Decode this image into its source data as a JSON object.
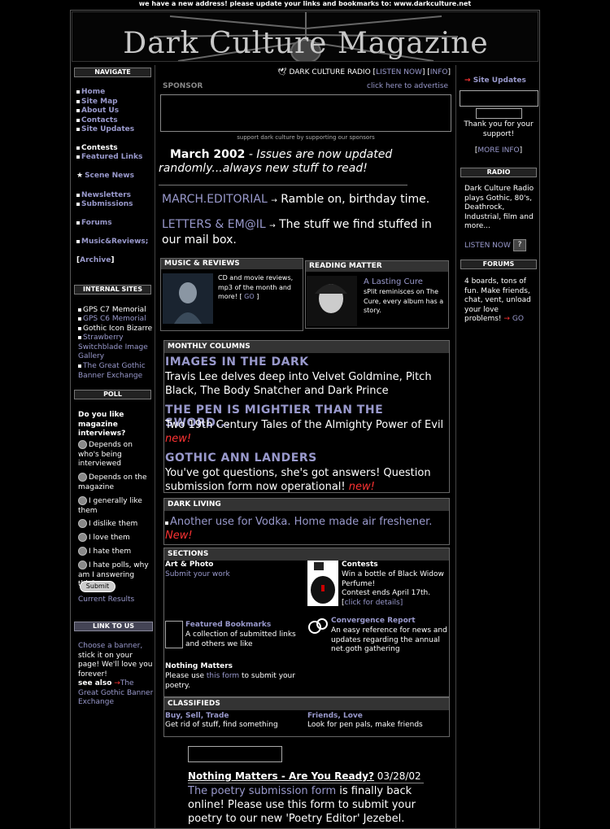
{
  "notice": "we have a new address! please update your links and bookmarks to: www.darkculture.net",
  "banner_title": "Dark Culture Magazine",
  "nav": {
    "header": "NAVIGATE",
    "items": [
      "Home",
      "Site Map",
      "About Us",
      "Contacts",
      "Site Updates"
    ],
    "contests": "Contests",
    "featured": "Featured Links",
    "scene": "Scene News",
    "newsletters": "Newsletters",
    "submissions": "Submissions",
    "forums": "Forums",
    "music": "Music&Reviews;",
    "archive": "Archive"
  },
  "internal": {
    "header": "INTERNAL SITES",
    "items": [
      "GPS C7 Memorial",
      "GPS C6 Memorial",
      "Gothic Icon Bizarre",
      "Strawberry Switchblade Image Gallery",
      "The Great Gothic Banner Exchange"
    ]
  },
  "poll": {
    "header": "POLL",
    "question": "Do you like magazine interviews?",
    "options": [
      "Depends on who's being interviewed",
      "Depends on the magazine",
      "I generally like them",
      "I dislike them",
      "I love them",
      "I hate them",
      "I hate polls, why am I answering this?"
    ],
    "submit": "Submit",
    "results": "Current Results"
  },
  "linkus": {
    "header": "LINK TO US",
    "text1": "Choose a banner,",
    "text2": "stick it on your page! We'll love you forever!",
    "see_also": "see also",
    "link": "The Great Gothic Banner Exchange"
  },
  "radio_bar": {
    "label": "DARK CULTURE RADIO [",
    "listen": "LISTEN NOW",
    "mid": "] [",
    "info": "INFO",
    "end": "]"
  },
  "sponsor": {
    "label": "SPONSOR",
    "advertise": "click here to advertise",
    "caption": "support dark culture by supporting our sponsors"
  },
  "headline": {
    "date": "March 2002",
    "text": "- Issues are now updated randomly...always new stuff to read!"
  },
  "editorial": {
    "link": "MARCH.EDITORIAL",
    "text": "Ramble on, birthday time."
  },
  "letters": {
    "link": "LETTERS & EM@IL",
    "text": "The stuff we find stuffed in our mail box."
  },
  "music": {
    "header": "MUSIC & REVIEWS",
    "text": "CD and movie reviews, mp3 of the month and more! [",
    "go": "GO",
    "end": "]"
  },
  "reading": {
    "header": "READING MATTER",
    "link": "A Lasting Cure",
    "text": "sPlit reminisces on The Cure, every album has a story."
  },
  "monthly": {
    "header": "MONTHLY COLUMNS",
    "c1_title": "IMAGES IN THE DARK",
    "c1_text": "Travis Lee delves deep into Velvet Goldmine, Pitch Black, The Body Snatcher and Dark Prince",
    "c2_title": "THE PEN IS MIGHTIER THAN THE SWORD...",
    "c2_text": "Two 19th Century Tales of the Almighty Power of Evil",
    "c3_title": "GOTHIC ANN LANDERS",
    "c3_text": "You've got questions, she's got answers! Question submission form now operational!",
    "new_lower": "new!"
  },
  "dark": {
    "header": "DARK LIVING",
    "link": "Another use for Vodka. Home made air freshener.",
    "new": "New!"
  },
  "sections": {
    "header": "SECTIONS",
    "art_title": "Art & Photo",
    "art_link": "Submit your work",
    "contests_title": "Contests",
    "contests_text": "Win a bottle of Black Widow Perfume!",
    "contests_ends": "Contest ends April 17th. [",
    "contests_click": "click for details",
    "contests_end": "]",
    "bookmarks_title": "Featured Bookmarks",
    "bookmarks_text": "A collection of submitted links and others we like",
    "conv_title": "Convergence Report",
    "conv_text": "An easy reference for news and updates regarding the annual net.goth gathering",
    "nm_title": "Nothing Matters",
    "nm_text1": "Please use",
    "nm_link": "this form",
    "nm_text2": "to submit your poetry."
  },
  "classifieds": {
    "header": "CLASSIFIEDS",
    "c1_title": "Buy, Sell, Trade",
    "c1_text": "Get rid of stuff, find something",
    "c2_title": "Friends, Love",
    "c2_text": "Look for pen pals, make friends"
  },
  "news": {
    "title": "Nothing Matters - Are You Ready?",
    "date": "03/28/02",
    "link": "The poetry submission form",
    "text": "is finally back online! Please use this form to submit your poetry to our new 'Poetry Editor' Jezebel."
  },
  "right": {
    "updates": "Site Updates",
    "thanks": "Thank you for your support!",
    "more_open": "[",
    "more": "MORE INFO",
    "more_close": "]",
    "radio_header": "RADIO",
    "radio_text": "Dark Culture Radio plays Gothic, 80's, Deathrock, Industrial, film and more...",
    "listen": "LISTEN NOW",
    "help": "?",
    "forums_header": "FORUMS",
    "forums_text": "4 boards, tons of fun. Make friends, chat, vent, unload your love problems!",
    "go": "GO"
  }
}
